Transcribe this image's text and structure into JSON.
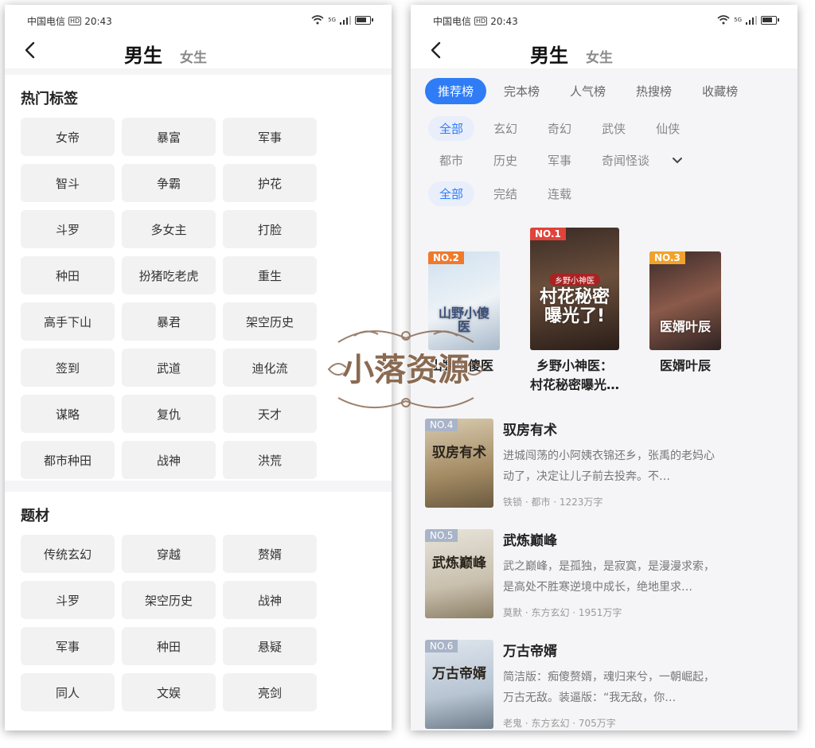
{
  "status_bar": {
    "carrier": "中国电信",
    "hd": "HD",
    "time": "20:43",
    "net": "5G"
  },
  "gender_tabs": {
    "active": "男生",
    "inactive": "女生"
  },
  "left": {
    "hot_tags_title": "热门标签",
    "hot_tags": [
      "女帝",
      "暴富",
      "军事",
      "智斗",
      "争霸",
      "护花",
      "斗罗",
      "多女主",
      "打脸",
      "种田",
      "扮猪吃老虎",
      "重生",
      "高手下山",
      "暴君",
      "架空历史",
      "签到",
      "武道",
      "迪化流",
      "谋略",
      "复仇",
      "天才",
      "都市种田",
      "战神",
      "洪荒"
    ],
    "topics_title": "题材",
    "topics": [
      "传统玄幻",
      "穿越",
      "赘婿",
      "斗罗",
      "架空历史",
      "战神",
      "军事",
      "种田",
      "悬疑",
      "同人",
      "文娱",
      "亮剑"
    ]
  },
  "right": {
    "rank_tabs": [
      "推荐榜",
      "完本榜",
      "人气榜",
      "热搜榜",
      "收藏榜"
    ],
    "category_filters_row1": [
      "全部",
      "玄幻",
      "奇幻",
      "武侠",
      "仙侠"
    ],
    "category_filters_row2": [
      "都市",
      "历史",
      "军事",
      "奇闻怪谈"
    ],
    "status_filters": [
      "全部",
      "完结",
      "连载"
    ],
    "top3": [
      {
        "rank": "NO.2",
        "title": "山野小傻医",
        "cover_text": "山野小傻医"
      },
      {
        "rank": "NO.1",
        "title": "乡野小神医：",
        "title2": "村花秘密曝光…",
        "cover_text_top": "乡野小神医",
        "cover_text": "村花秘密曝光了!"
      },
      {
        "rank": "NO.3",
        "title": "医婿叶辰",
        "cover_text": "医婿叶辰"
      }
    ],
    "list": [
      {
        "rank": "NO.4",
        "title": "驭房有术",
        "desc": "进城闯荡的小阿姨衣锦还乡，张禹的老妈心动了，决定让儿子前去投奔。不…",
        "meta": "铁锁 · 都市 · 1223万字",
        "cover_text": "驭房有术"
      },
      {
        "rank": "NO.5",
        "title": "武炼巅峰",
        "desc": "武之巅峰，是孤独，是寂寞，是漫漫求索，是高处不胜寒逆境中成长，绝地里求…",
        "meta": "莫默 · 东方玄幻 · 1951万字",
        "cover_text": "武炼巅峰"
      },
      {
        "rank": "NO.6",
        "title": "万古帝婿",
        "desc": "简洁版：痴傻赘婿，魂归来兮，一朝崛起，万古无敌。装逼版：“我无敌，你…",
        "meta": "老鬼 · 东方玄幻 · 705万字",
        "cover_text": "万古帝婿"
      }
    ]
  },
  "watermark": {
    "text": "小落资源"
  },
  "colors": {
    "accent": "#2f7cf6",
    "rank1": "#e0433a",
    "rank2": "#f07a2c",
    "rank3": "#f0a32c",
    "rank_gray": "#a9b4c8"
  }
}
